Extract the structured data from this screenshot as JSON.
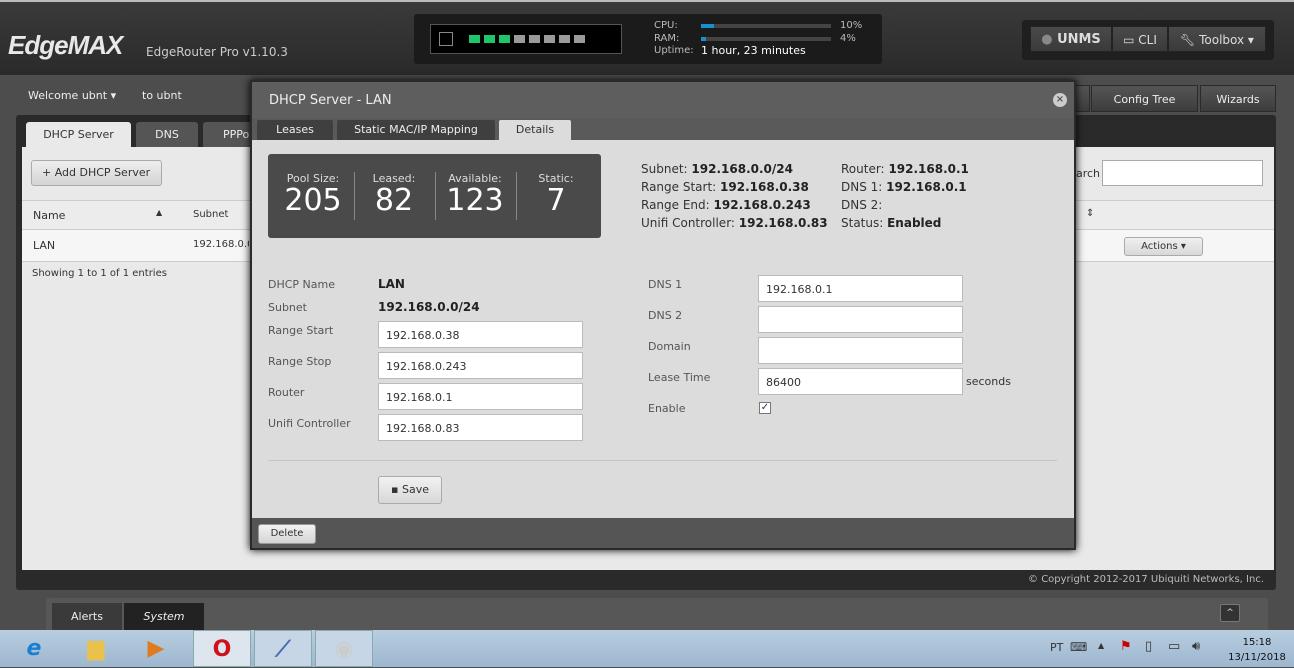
{
  "header": {
    "logo": "EdgeMAX",
    "model": "EdgeRouter Pro v1.10.3",
    "cpu_label": "CPU:",
    "cpu_value": "10%",
    "cpu_pct": 10,
    "ram_label": "RAM:",
    "ram_value": "4%",
    "ram_pct": 4,
    "uptime_label": "Uptime:",
    "uptime": "1 hour, 23 minutes",
    "ports": [
      "up",
      "up",
      "up",
      "down",
      "down",
      "down",
      "down",
      "down"
    ],
    "unms": "UNMS",
    "cli": "CLI",
    "toolbox": "Toolbox"
  },
  "nav": {
    "welcome": "Welcome ubnt",
    "to": "to ubnt",
    "config_tree": "Config Tree",
    "wizards": "Wizards"
  },
  "main": {
    "tabs": [
      "DHCP Server",
      "DNS",
      "PPPoE"
    ],
    "add_button": "Add DHCP Server",
    "search_label": "Search",
    "columns": [
      "Name",
      "Subnet"
    ],
    "rows": [
      {
        "name": "LAN",
        "subnet": "192.168.0.0/24",
        "actions": "Actions"
      }
    ],
    "showing": "Showing 1 to 1 of 1 entries",
    "copyright": "© Copyright 2012-2017 Ubiquiti Networks, Inc."
  },
  "modal": {
    "title": "DHCP Server - LAN",
    "tabs": [
      "Leases",
      "Static MAC/IP Mapping",
      "Details"
    ],
    "stats": [
      {
        "label": "Pool Size:",
        "value": "205"
      },
      {
        "label": "Leased:",
        "value": "82"
      },
      {
        "label": "Available:",
        "value": "123"
      },
      {
        "label": "Static:",
        "value": "7"
      }
    ],
    "summary_left": [
      {
        "k": "Subnet:",
        "v": "192.168.0.0/24"
      },
      {
        "k": "Range Start:",
        "v": "192.168.0.38"
      },
      {
        "k": "Range End:",
        "v": "192.168.0.243"
      },
      {
        "k": "Unifi Controller:",
        "v": "192.168.0.83"
      }
    ],
    "summary_right": [
      {
        "k": "Router:",
        "v": "192.168.0.1"
      },
      {
        "k": "DNS 1:",
        "v": "192.168.0.1"
      },
      {
        "k": "DNS 2:",
        "v": ""
      },
      {
        "k": "Status:",
        "v": "Enabled"
      }
    ],
    "form": {
      "dhcp_name_label": "DHCP Name",
      "dhcp_name": "LAN",
      "subnet_label": "Subnet",
      "subnet": "192.168.0.0/24",
      "range_start_label": "Range Start",
      "range_start": "192.168.0.38",
      "range_stop_label": "Range Stop",
      "range_stop": "192.168.0.243",
      "router_label": "Router",
      "router": "192.168.0.1",
      "unifi_label": "Unifi Controller",
      "unifi": "192.168.0.83",
      "dns1_label": "DNS 1",
      "dns1": "192.168.0.1",
      "dns2_label": "DNS 2",
      "dns2": "",
      "domain_label": "Domain",
      "domain": "",
      "lease_label": "Lease Time",
      "lease": "86400",
      "lease_unit": "seconds",
      "enable_label": "Enable",
      "enabled": true
    },
    "save": "Save",
    "delete": "Delete"
  },
  "dock": {
    "tabs": [
      "Alerts",
      "System"
    ]
  },
  "taskbar": {
    "lang": "PT",
    "time": "15:18",
    "date": "13/11/2018"
  }
}
